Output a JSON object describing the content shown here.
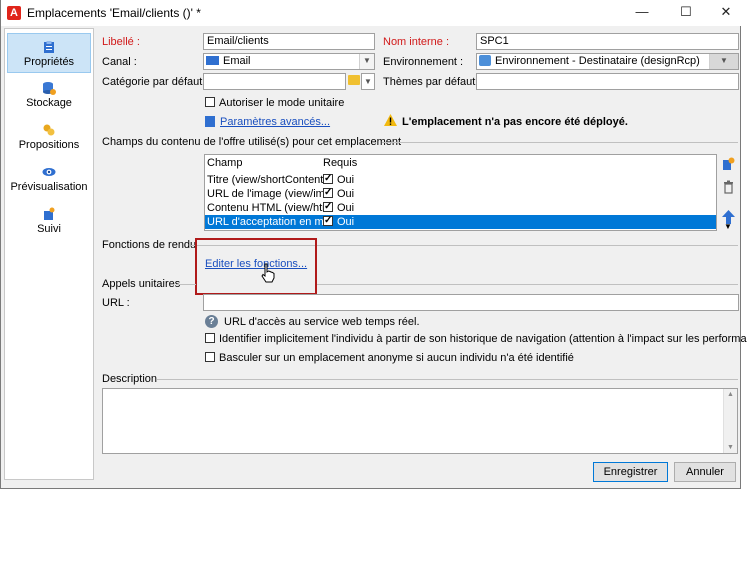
{
  "window": {
    "title": "Emplacements 'Email/clients ()' *",
    "app_icon": "A",
    "minimize": "—",
    "maximize": "☐",
    "close": "✕"
  },
  "sidebar": {
    "items": [
      {
        "label": "Propriétés",
        "icon": "clipboard-icon"
      },
      {
        "label": "Stockage",
        "icon": "database-icon"
      },
      {
        "label": "Propositions",
        "icon": "coins-icon"
      },
      {
        "label": "Prévisualisation",
        "icon": "eye-icon"
      },
      {
        "label": "Suivi",
        "icon": "tracking-icon"
      }
    ]
  },
  "form": {
    "libelle_label": "Libellé :",
    "libelle_value": "Email/clients",
    "nom_interne_label": "Nom interne :",
    "nom_interne_value": "SPC1",
    "canal_label": "Canal :",
    "canal_value": "Email",
    "environnement_label": "Environnement :",
    "environnement_value": "Environnement - Destinataire (designRcp)",
    "categorie_label": "Catégorie par défaut :",
    "categorie_value": "",
    "themes_label": "Thèmes par défaut :",
    "themes_value": "",
    "autoriser_label": "Autoriser le mode unitaire",
    "parametres_link": "Paramètres avancés...",
    "warning_text": "L'emplacement n'a pas encore été déployé."
  },
  "champs": {
    "section_title": "Champs du contenu de l'offre utilisé(s) pour cet emplacement",
    "columns": [
      "Champ",
      "Requis"
    ],
    "rows": [
      {
        "champ": "Titre (view/shortContent)",
        "requis": "Oui"
      },
      {
        "champ": "URL de l'image (view/image)",
        "requis": "Oui"
      },
      {
        "champ": "Contenu HTML (view/htmlSource)",
        "requis": "Oui"
      },
      {
        "champ": "URL d'acceptation en mode",
        "requis": "Oui"
      }
    ]
  },
  "fonctions": {
    "section_title": "Fonctions de rendu",
    "link": "Editer les fonctions..."
  },
  "appels": {
    "section_title": "Appels unitaires",
    "url_label": "URL :",
    "url_value": "",
    "help_text": "URL d'accès au service web temps réel.",
    "identifier_label": "Identifier implicitement l'individu à partir de son historique de navigation (attention à l'impact sur les performances)",
    "basculer_label": "Basculer sur un emplacement anonyme si aucun individu n'a été identifié"
  },
  "description": {
    "section_title": "Description",
    "value": ""
  },
  "buttons": {
    "save": "Enregistrer",
    "cancel": "Annuler"
  },
  "colors": {
    "accent": "#0078d7",
    "required": "#d11a1a",
    "highlight_box": "#b01a1a",
    "link": "#1a4fbf"
  }
}
